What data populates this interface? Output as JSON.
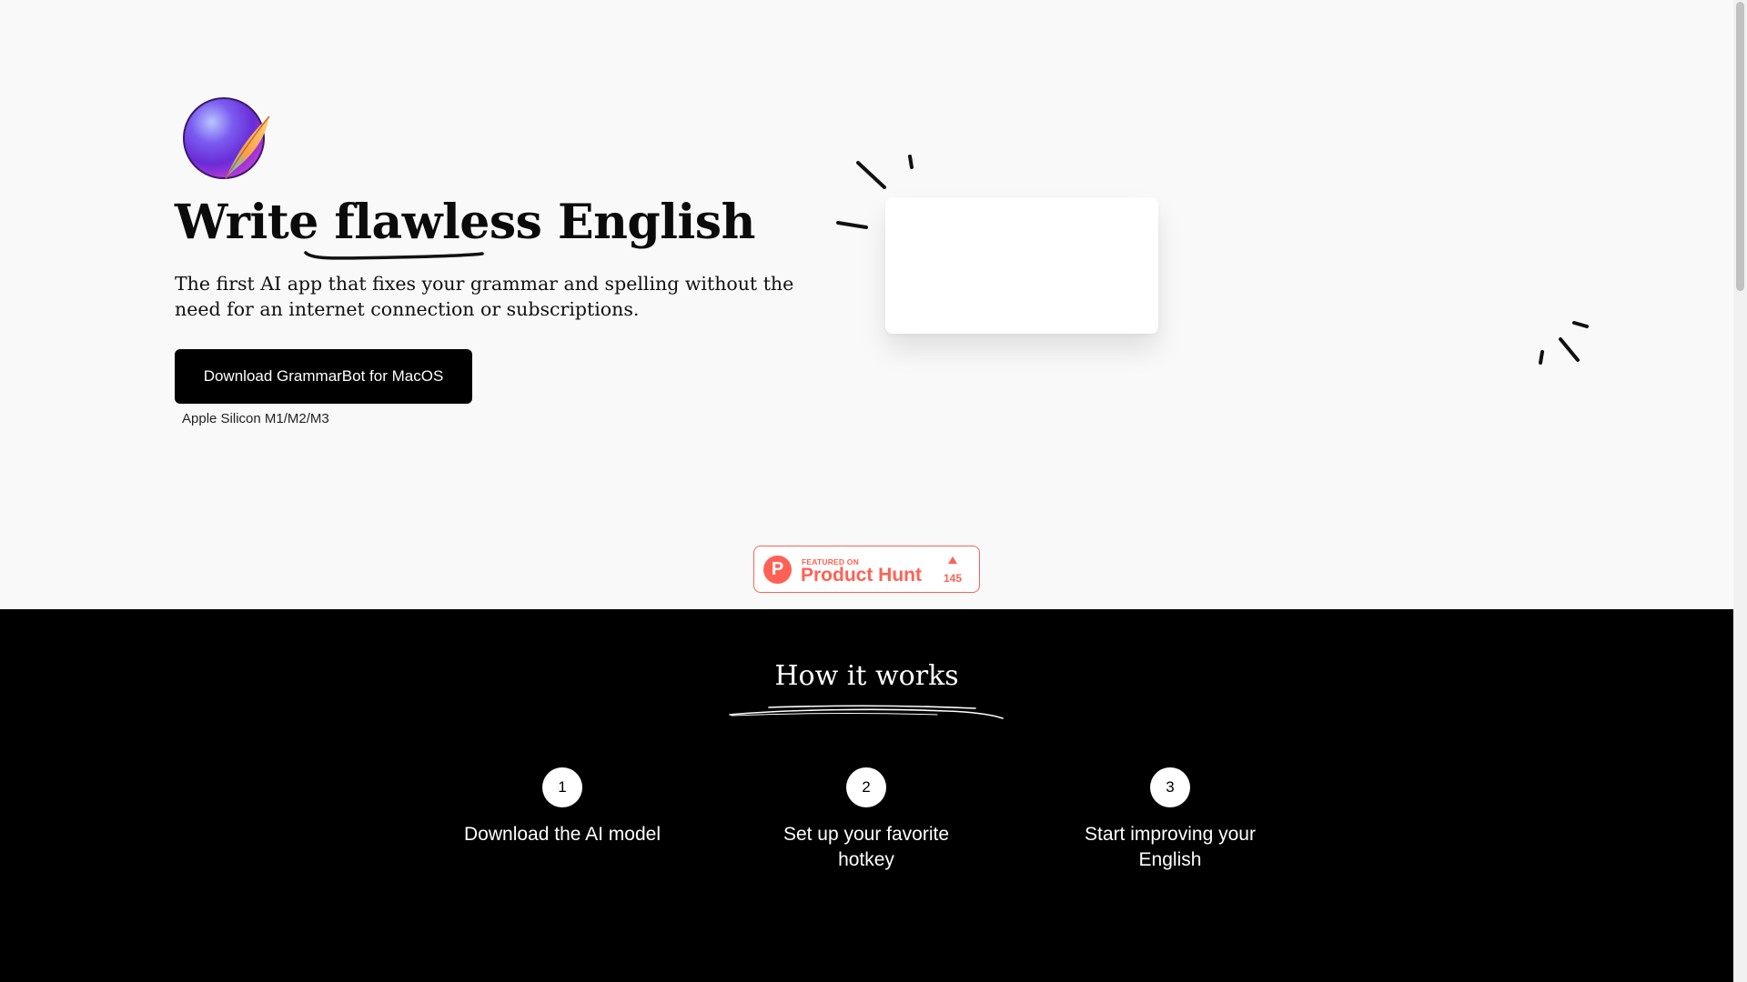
{
  "hero": {
    "headline_start": "Write ",
    "headline_emphasis": "flawless",
    "headline_end": " English",
    "subtitle": "The first AI app that fixes your grammar and spelling without the need for an internet connection or subscriptions.",
    "download_label": "Download GrammarBot for MacOS",
    "download_caption": "Apple Silicon M1/M2/M3",
    "logo_icon": "feather-orb-logo"
  },
  "product_hunt": {
    "featured_label": "FEATURED ON",
    "name": "Product Hunt",
    "logo_letter": "P",
    "upvotes": "145",
    "accent": "#ff6154"
  },
  "how_it_works": {
    "title": "How it works",
    "steps": [
      {
        "number": "1",
        "label": "Download the AI model"
      },
      {
        "number": "2",
        "label": "Set up your favorite hotkey"
      },
      {
        "number": "3",
        "label": "Start improving your English"
      }
    ]
  },
  "colors": {
    "hero_background": "#f9f9f9",
    "section_background": "#000000",
    "button_background": "#000000",
    "text_primary": "#0b0b0b"
  }
}
